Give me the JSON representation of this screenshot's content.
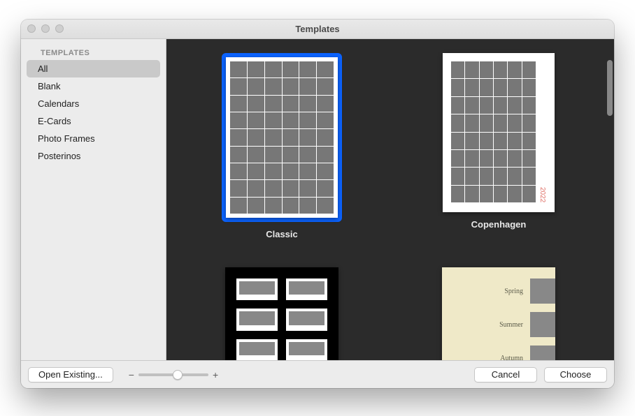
{
  "window": {
    "title": "Templates"
  },
  "sidebar": {
    "header": "TEMPLATES",
    "items": [
      {
        "label": "All",
        "selected": true
      },
      {
        "label": "Blank",
        "selected": false
      },
      {
        "label": "Calendars",
        "selected": false
      },
      {
        "label": "E-Cards",
        "selected": false
      },
      {
        "label": "Photo Frames",
        "selected": false
      },
      {
        "label": "Posterinos",
        "selected": false
      }
    ]
  },
  "templates": [
    {
      "label": "Classic",
      "kind": "classic",
      "selected": true
    },
    {
      "label": "Copenhagen",
      "kind": "copenhagen",
      "selected": false,
      "side_text": "2022"
    },
    {
      "label": "",
      "kind": "polaroid",
      "selected": false
    },
    {
      "label": "",
      "kind": "seasons",
      "selected": false,
      "rows": [
        {
          "label": "Spring"
        },
        {
          "label": "Summer"
        },
        {
          "label": "Autumn"
        }
      ]
    }
  ],
  "zoom": {
    "minus": "−",
    "plus": "+"
  },
  "buttons": {
    "open_existing": "Open Existing...",
    "cancel": "Cancel",
    "choose": "Choose"
  }
}
